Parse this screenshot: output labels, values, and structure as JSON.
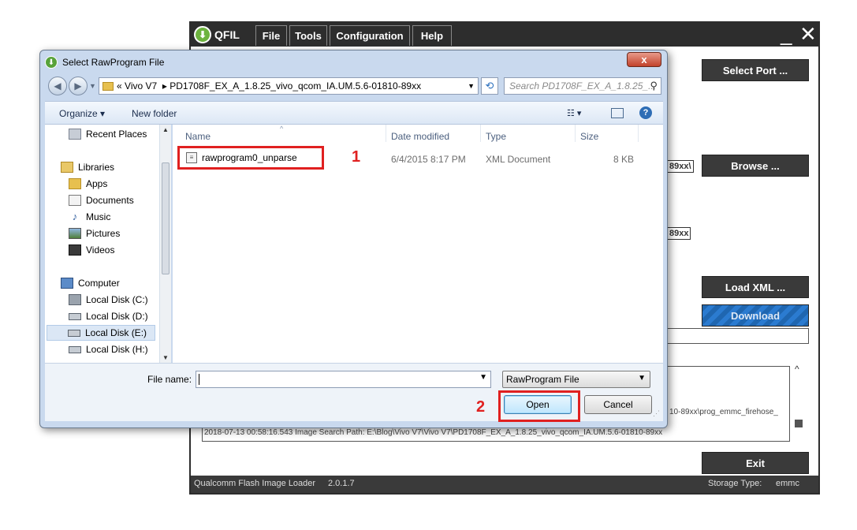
{
  "qfil": {
    "app_name": "QFIL",
    "menu": [
      "File",
      "Tools",
      "Configuration",
      "Help"
    ],
    "window_controls": {
      "minimize": "_",
      "close": "✕"
    },
    "buttons": {
      "select_port": "Select Port ...",
      "browse": "Browse ...",
      "load_xml": "Load XML ...",
      "download": "Download",
      "exit": "Exit"
    },
    "snippets": {
      "browse_path_tail": "89xx\\",
      "xml_path_tail": "89xx"
    },
    "log": {
      "line1_tail": "10-89xx\\prog_emmc_firehose_",
      "line2": "2018-07-13 00:58:16.543    Image Search Path: E:\\Blog\\Vivo V7\\Vivo V7\\PD1708F_EX_A_1.8.25_vivo_qcom_IA.UM.5.6-01810-89xx"
    },
    "status_bar": {
      "app_label": "Qualcomm Flash Image Loader",
      "version": "2.0.1.7",
      "storage_label": "Storage Type:",
      "storage_value": "emmc"
    },
    "accent_color": "#2b7bd0"
  },
  "dialog": {
    "title": "Select RawProgram File",
    "close_label": "x",
    "address": {
      "prefix": "«",
      "segment1": "Vivo V7",
      "separator": "▸",
      "segment2": "PD1708F_EX_A_1.8.25_vivo_qcom_IA.UM.5.6-01810-89xx"
    },
    "search_placeholder": "Search PD1708F_EX_A_1.8.25_...",
    "toolbar": {
      "organize": "Organize ▾",
      "new_folder": "New folder"
    },
    "nav_items": [
      {
        "label": "Recent Places",
        "icon": "recent-places-icon"
      },
      {
        "label": "Libraries",
        "icon": "libraries-icon"
      },
      {
        "label": "Apps",
        "icon": "folder-icon"
      },
      {
        "label": "Documents",
        "icon": "documents-icon"
      },
      {
        "label": "Music",
        "icon": "music-icon"
      },
      {
        "label": "Pictures",
        "icon": "pictures-icon"
      },
      {
        "label": "Videos",
        "icon": "videos-icon"
      },
      {
        "label": "Computer",
        "icon": "computer-icon"
      },
      {
        "label": "Local Disk (C:)",
        "icon": "drive-icon"
      },
      {
        "label": "Local Disk (D:)",
        "icon": "drive-icon"
      },
      {
        "label": "Local Disk (E:)",
        "icon": "drive-icon",
        "selected": true
      },
      {
        "label": "Local Disk (H:)",
        "icon": "drive-icon"
      }
    ],
    "columns": [
      "Name",
      "Date modified",
      "Type",
      "Size"
    ],
    "files": [
      {
        "name": "rawprogram0_unparse",
        "date": "6/4/2015 8:17 PM",
        "type": "XML Document",
        "size": "8 KB"
      }
    ],
    "annotations": [
      "1",
      "2"
    ],
    "file_name_label": "File name:",
    "file_name_value": "",
    "filter": "RawProgram File",
    "open_label": "Open",
    "cancel_label": "Cancel",
    "highlight_color": "#e02020"
  }
}
